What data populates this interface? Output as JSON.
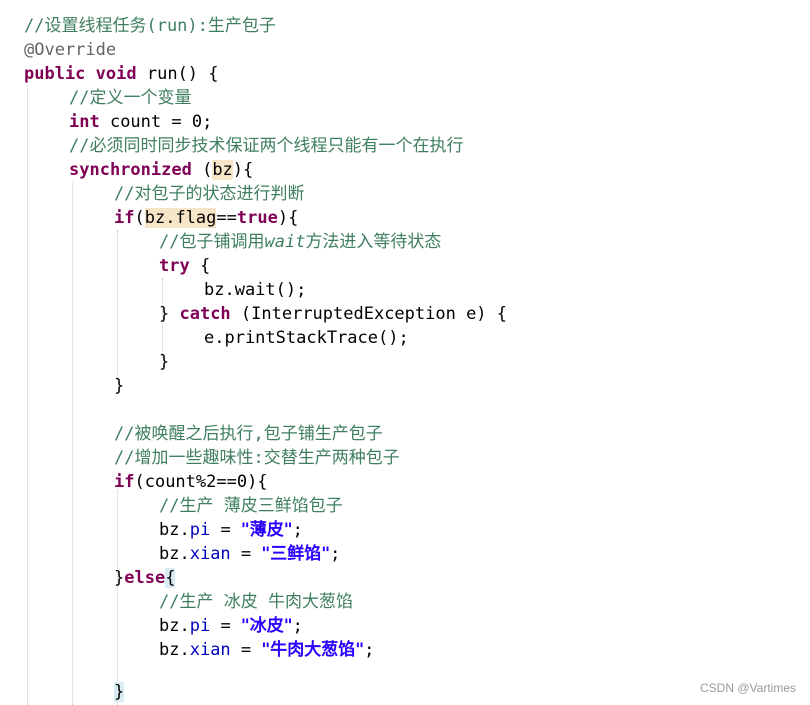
{
  "editor": {
    "lines": [
      {
        "comment": "//设置线程任务(run):生产包子"
      },
      {
        "annotation": "@Override"
      },
      {
        "kw1": "public",
        "kw2": "void",
        "text": " run() {"
      },
      {
        "comment": "//定义一个变量"
      },
      {
        "kw": "int",
        "text": " count = 0;"
      },
      {
        "comment": "//必须同时同步技术保证两个线程只能有一个在执行"
      },
      {
        "kw": "synchronized",
        "open": " (",
        "var": "bz",
        "close": "){"
      },
      {
        "comment": "//对包子的状态进行判断"
      },
      {
        "kw": "if",
        "open": "(",
        "var": "bz.flag",
        "op": "==",
        "kw2": "true",
        "close": "){"
      },
      {
        "comment_a": "//包子铺调用",
        "comment_b": "wait",
        "comment_c": "方法进入等待状态"
      },
      {
        "kw": "try",
        "text": " {"
      },
      {
        "text": "bz.wait();"
      },
      {
        "text_a": "} ",
        "kw": "catch",
        "text_b": " (InterruptedException e) {"
      },
      {
        "text": "e.printStackTrace();"
      },
      {
        "text": "}"
      },
      {
        "text": "}"
      },
      {
        "comment": "//被唤醒之后执行,包子铺生产包子"
      },
      {
        "comment": "//增加一些趣味性:交替生产两种包子"
      },
      {
        "kw": "if",
        "text": "(count%2==0){"
      },
      {
        "comment": "//生产 薄皮三鲜馅包子"
      },
      {
        "obj": "bz.",
        "field": "pi",
        "eq": " = ",
        "str": "\"薄皮\"",
        "end": ";"
      },
      {
        "obj": "bz.",
        "field": "xian",
        "eq": " = ",
        "str": "\"三鲜馅\"",
        "end": ";"
      },
      {
        "text_a": "}",
        "kw": "else",
        "text_b": "{"
      },
      {
        "comment": "//生产 冰皮 牛肉大葱馅"
      },
      {
        "obj": "bz.",
        "field": "pi",
        "eq": " = ",
        "str": "\"冰皮\"",
        "end": ";"
      },
      {
        "obj": "bz.",
        "field": "xian",
        "eq": " = ",
        "str": "\"牛肉大葱馅\"",
        "end": ";"
      },
      {
        "text": "}"
      }
    ]
  },
  "watermark": "CSDN @Vartimes"
}
